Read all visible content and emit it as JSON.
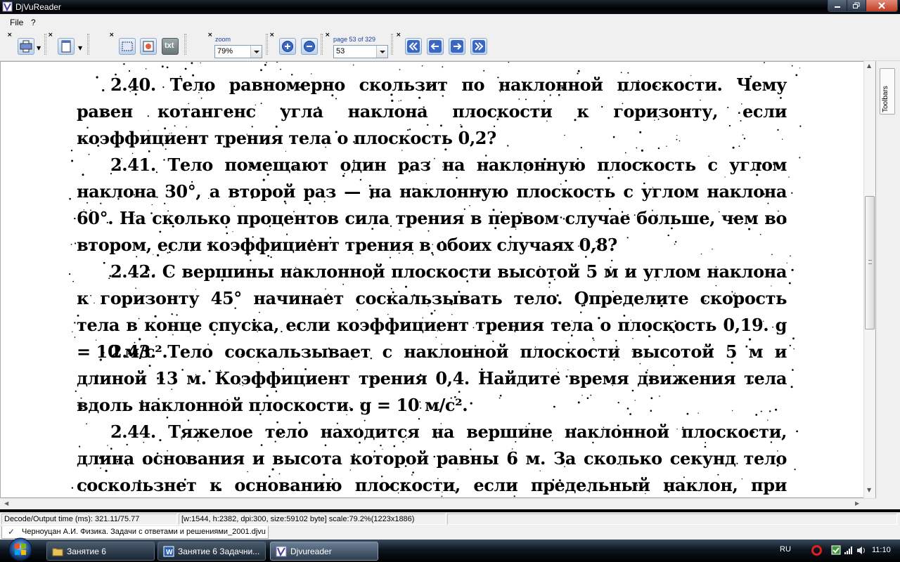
{
  "window": {
    "title": "DjVuReader"
  },
  "menu": {
    "file": "File",
    "help": "?"
  },
  "toolbar": {
    "zoom_label": "zoom",
    "zoom_value": "79%",
    "page_label": "page 53 of 329",
    "page_value": "53",
    "text_button": "txt"
  },
  "page_text": {
    "p1": "2.40. Тело равномерно скользит по наклонной плоскости. Чему равен котангенс угла наклона плоскости к горизонту, если коэффициент трения тела о плоскость 0,2?",
    "p2": "2.41. Тело помещают один раз на наклонную плоскость с углом наклона 30°, а второй раз — на наклонную плоскость с углом наклона 60°. На сколько процентов сила трения в первом случае больше, чем во втором, если коэффициент трения в обоих случаях 0,8?",
    "p3": "2.42. С вершины наклонной плоскости высотой 5 м и углом наклона к горизонту 45° начинает соскальзывать тело. Определите скорость тела в конце спуска, если коэффициент трения тела о плоскость 0,19. g = 10 м/с².",
    "p4": "2.43. Тело соскальзывает с наклонной плоскости высотой 5 м и длиной 13 м. Коэффициент трения 0,4. Найдите время движения тела вдоль наклонной плоскости. g = 10 м/с².",
    "p5": "2.44. Тяжелое тело находится на вершине наклонной плоскости, длина основания и высота которой равны 6 м. За сколько секунд тело соскользнет к основанию плоскости, если предельный наклон, при котором тело находится на этой"
  },
  "side_panel": {
    "toolbars_label": "Toolbars"
  },
  "status": {
    "decode_time": "Decode/Output time (ms): 321.11/75.77",
    "page_info": "[w:1544, h:2382, dpi:300, size:59102 byte] scale:79.2%(1223x1886)"
  },
  "document_tab": {
    "label": "Черноуцан А.И. Физика. Задачи с ответами и решениями_2001.djvu"
  },
  "taskbar": {
    "tasks": [
      {
        "label": "Занятие 6"
      },
      {
        "label": "Занятие 6 Задачни..."
      },
      {
        "label": "Djvureader"
      }
    ],
    "language": "RU",
    "clock": "11:10"
  },
  "colors": {
    "accent_blue": "#1a3fa0",
    "titlebar": "#000000",
    "close_red": "#c13c22"
  }
}
